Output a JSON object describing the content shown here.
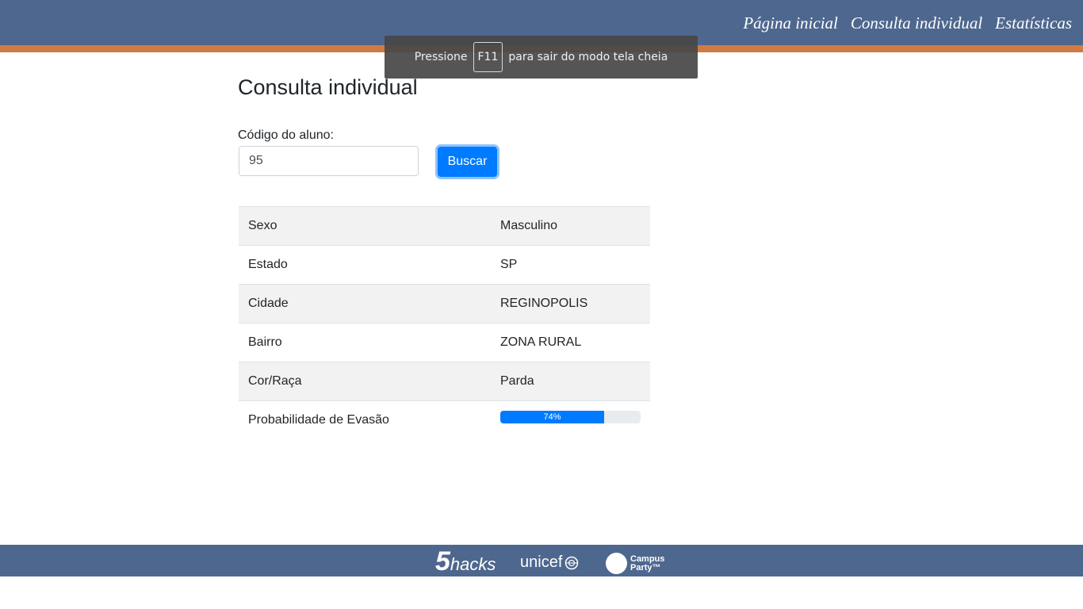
{
  "nav": {
    "items": [
      "Página inicial",
      "Consulta individual",
      "Estatísticas"
    ]
  },
  "fullscreen_toast": {
    "before": "Pressione",
    "key": "F11",
    "after": "para sair do modo tela cheia"
  },
  "page": {
    "title": "Consulta individual"
  },
  "form": {
    "label": "Código do aluno:",
    "value": "95",
    "button_label": "Buscar"
  },
  "results": {
    "rows": [
      {
        "label": "Sexo",
        "value": "Masculino"
      },
      {
        "label": "Estado",
        "value": "SP"
      },
      {
        "label": "Cidade",
        "value": "REGINOPOLIS"
      },
      {
        "label": "Bairro",
        "value": "ZONA RURAL"
      },
      {
        "label": "Cor/Raça",
        "value": "Parda"
      }
    ],
    "dropout": {
      "label": "Probabilidade de Evasão",
      "percent": 74,
      "percent_label": "74%"
    }
  },
  "footer": {
    "logo_5hacks": {
      "number": "5",
      "word": "hacks"
    },
    "logo_unicef": "unicef",
    "logo_campus_party": {
      "line1": "Campus",
      "line2": "Party™"
    }
  },
  "colors": {
    "header": "#4e678e",
    "header_stripe": "#d07b45",
    "primary": "#007bff",
    "striped_row": "#f2f2f2"
  }
}
